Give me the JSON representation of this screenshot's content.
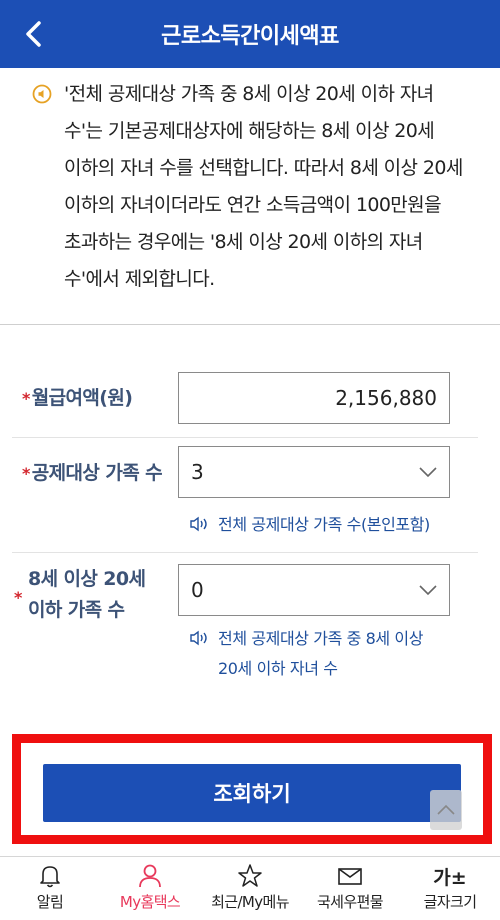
{
  "header": {
    "title": "근로소득간이세액표"
  },
  "notice": {
    "text": "'전체 공제대상 가족 중 8세 이상 20세 이하 자녀 수'는 기본공제대상자에 해당하는 8세 이상 20세 이하의 자녀 수를 선택합니다. 따라서 8세 이상 20세 이하의 자녀이더라도 연간 소득금액이 100만원을 초과하는 경우에는 '8세 이상 20세 이하의 자녀 수'에서 제외합니다."
  },
  "form": {
    "required_mark": "*",
    "salary": {
      "label": "월급여액(원)",
      "value": "2,156,880"
    },
    "family": {
      "label": "공제대상 가족 수",
      "value": "3",
      "hint": "전체 공제대상 가족 수(본인포함)"
    },
    "children": {
      "label_line1": "8세 이상 20세",
      "label_line2": "이하 가족 수",
      "value": "0",
      "hint_line1": "전체 공제대상 가족 중 8세 이상",
      "hint_line2": "20세 이하 자녀 수"
    }
  },
  "button": {
    "label": "조회하기"
  },
  "tabbar": {
    "items": [
      {
        "label": "알림",
        "icon": "bell-icon"
      },
      {
        "label": "My홈택스",
        "icon": "person-icon",
        "active": true
      },
      {
        "label": "최근/My메뉴",
        "icon": "star-icon"
      },
      {
        "label": "국세우편물",
        "icon": "mail-icon"
      },
      {
        "label": "글자크기",
        "icon": "font-size-icon",
        "glyph": "가±"
      }
    ]
  },
  "colors": {
    "header": "#1c4fb5",
    "button": "#1c4fb5",
    "highlight_border": "#ef0f0f",
    "required": "#d3262e",
    "label": "#3d5377",
    "active_tab": "#e8395b"
  }
}
